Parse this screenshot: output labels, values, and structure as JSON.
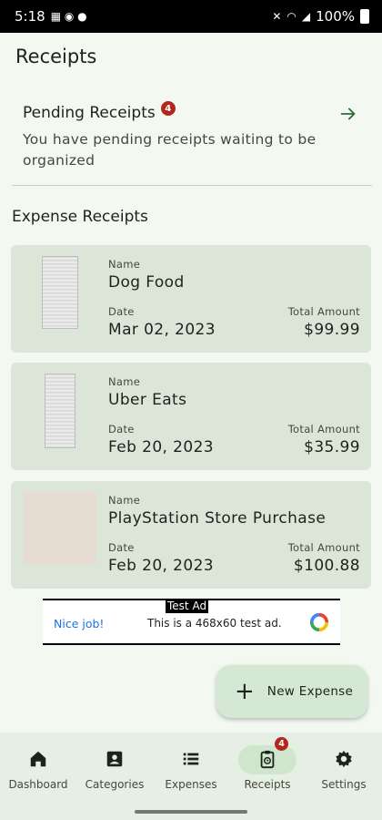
{
  "status_bar": {
    "time": "5:18",
    "battery": "100%"
  },
  "header": {
    "title": "Receipts"
  },
  "pending": {
    "title": "Pending Receipts",
    "badge": "4",
    "description": "You have pending receipts waiting to be organized"
  },
  "section": {
    "title": "Expense Receipts"
  },
  "receipts": [
    {
      "name_label": "Name",
      "name": "Dog Food",
      "date_label": "Date",
      "date": "Mar 02, 2023",
      "amount_label": "Total Amount",
      "amount": "$99.99"
    },
    {
      "name_label": "Name",
      "name": "Uber Eats",
      "date_label": "Date",
      "date": "Feb 20, 2023",
      "amount_label": "Total Amount",
      "amount": "$35.99"
    },
    {
      "name_label": "Name",
      "name": "PlayStation Store Purchase",
      "date_label": "Date",
      "date": "Feb 20, 2023",
      "amount_label": "Total Amount",
      "amount": "$100.88"
    }
  ],
  "ad": {
    "tag": "Test Ad",
    "nice": "Nice job!",
    "text": "This is a 468x60 test ad."
  },
  "fab": {
    "label": "New Expense"
  },
  "nav": {
    "items": [
      {
        "label": "Dashboard",
        "icon": "home-icon"
      },
      {
        "label": "Categories",
        "icon": "categories-icon"
      },
      {
        "label": "Expenses",
        "icon": "list-icon"
      },
      {
        "label": "Receipts",
        "icon": "receipt-icon",
        "badge": "4",
        "active": true
      },
      {
        "label": "Settings",
        "icon": "gear-icon"
      }
    ]
  },
  "colors": {
    "background": "#f3f8f1",
    "card": "#dbe6d8",
    "badge": "#b3261e",
    "fab": "#d4e8d3",
    "nav_active": "#cfe6cc"
  }
}
